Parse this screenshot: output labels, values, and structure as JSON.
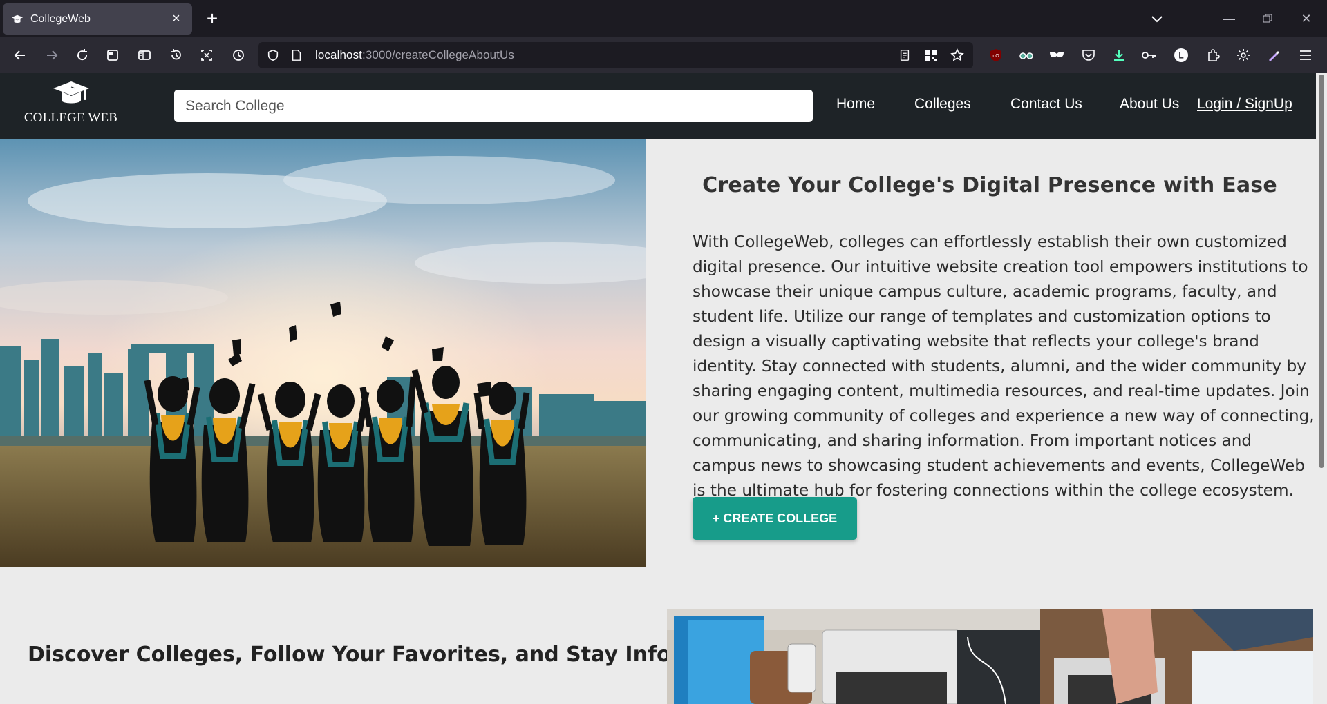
{
  "browser": {
    "tab_title": "CollegeWeb",
    "url_host": "localhost",
    "url_rest": ":3000/createCollegeAboutUs"
  },
  "site": {
    "logo_text": "COLLEGE WEB",
    "search_placeholder": "Search College",
    "nav": {
      "home": "Home",
      "colleges": "Colleges",
      "contact": "Contact Us",
      "about": "About Us",
      "login": "Login / SignUp"
    }
  },
  "hero": {
    "title": "Create Your College's Digital Presence with Ease",
    "body": "With CollegeWeb, colleges can effortlessly establish their own customized digital presence. Our intuitive website creation tool empowers institutions to showcase their unique campus culture, academic programs, faculty, and student life. Utilize our range of templates and customization options to design a visually captivating website that reflects your college's brand identity. Stay connected with students, alumni, and the wider community by sharing engaging content, multimedia resources, and real-time updates. Join our growing community of colleges and experience a new way of connecting, communicating, and sharing information. From important notices and campus news to showcasing student achievements and events, CollegeWeb is the ultimate hub for fostering connections within the college ecosystem.",
    "button": "+ CREATE COLLEGE"
  },
  "section2": {
    "title": "Discover Colleges, Follow Your Favorites, and Stay Informed"
  },
  "colors": {
    "header_bg": "#1e2327",
    "accent": "#179c8a",
    "page_bg": "#ebebeb"
  }
}
